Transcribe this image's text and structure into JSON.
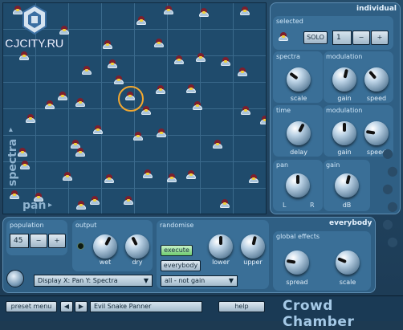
{
  "watermark": "CJCITY.RU",
  "field": {
    "axis_y_label": "spectra",
    "axis_x_label": "pan"
  },
  "individual": {
    "header": "individual",
    "selected": {
      "label": "selected",
      "solo_label": "SOLO",
      "number": "1",
      "minus": "−",
      "plus": "+"
    },
    "spectra": {
      "label": "spectra",
      "knob": "scale",
      "knob_value": 0.3
    },
    "modulation1": {
      "label": "modulation",
      "gain": "gain",
      "speed": "speed",
      "gain_value": 0.55,
      "speed_value": 0.35
    },
    "time": {
      "label": "time",
      "knob": "delay",
      "knob_value": 0.6
    },
    "modulation2": {
      "label": "modulation",
      "gain": "gain",
      "speed": "speed",
      "gain_value": 0.5,
      "speed_value": 0.2
    },
    "pan": {
      "label": "pan",
      "left": "L",
      "right": "R",
      "value": 0.5
    },
    "gain": {
      "label": "gain",
      "unit": "dB",
      "value": 0.55
    }
  },
  "everybody": {
    "header": "everybody",
    "population": {
      "label": "population",
      "value": "45",
      "minus": "−",
      "plus": "+"
    },
    "output": {
      "label": "output",
      "wet": "wet",
      "dry": "dry",
      "wet_value": 0.6,
      "dry_value": 0.4
    },
    "randomise": {
      "label": "randomise",
      "execute": "execute",
      "everybody": "everybody",
      "lower": "lower",
      "upper": "upper",
      "mode": "all - not gain",
      "lower_value": 0.5,
      "upper_value": 0.55
    },
    "display": "Display  X: Pan   Y: Spectra",
    "global_effects": {
      "label": "global effects",
      "spread": "spread",
      "scale": "scale",
      "spread_value": 0.2,
      "scale_value": 0.25
    }
  },
  "bottom": {
    "preset_menu": "preset menu",
    "preset_name": "Evil Snake Panner",
    "help": "help",
    "brand": "Crowd Chamber"
  }
}
